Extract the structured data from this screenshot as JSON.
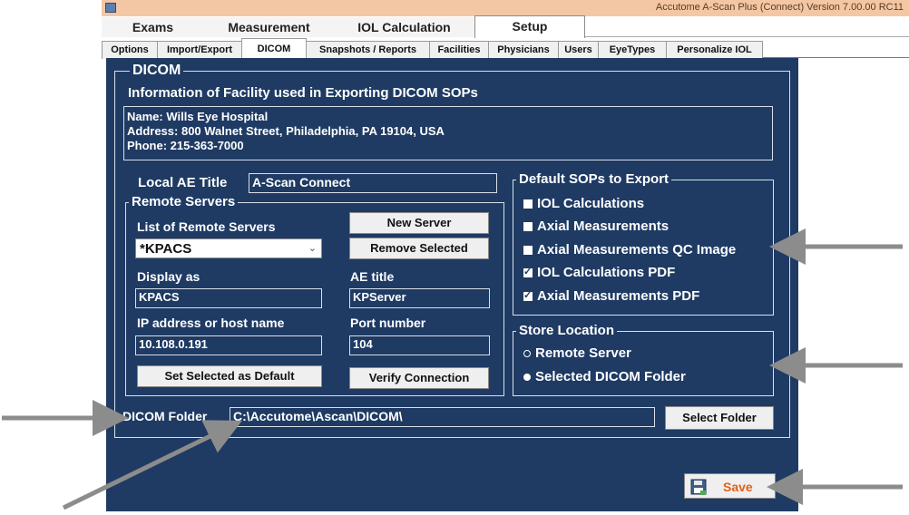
{
  "window": {
    "title": "Accutome A-Scan Plus (Connect) Version 7.00.00 RC11"
  },
  "main_tabs": [
    "Exams",
    "Measurement",
    "IOL Calculation",
    "Setup"
  ],
  "sub_tabs": [
    "Options",
    "Import/Export",
    "DICOM",
    "Snapshots / Reports",
    "Facilities",
    "Physicians",
    "Users",
    "EyeTypes",
    "Personalize IOL"
  ],
  "dicom": {
    "group_title": "DICOM",
    "facility_heading": "Information of Facility used in Exporting DICOM SOPs",
    "facility_lines": [
      "Name: Wills Eye Hospital",
      "Address: 800 Walnet Street, Philadelphia, PA 19104, USA",
      "Phone: 215-363-7000"
    ],
    "local_ae_label": "Local AE Title",
    "local_ae_value": "A-Scan Connect",
    "remote_servers": {
      "title": "Remote Servers",
      "list_label": "List of Remote Servers",
      "selected": "*KPACS",
      "new_server": "New Server",
      "remove_selected": "Remove Selected",
      "display_as_label": "Display as",
      "display_as_value": "KPACS",
      "ae_title_label": "AE title",
      "ae_title_value": "KPServer",
      "ip_label": "IP address or host name",
      "ip_value": "10.108.0.191",
      "port_label": "Port number",
      "port_value": "104",
      "set_default": "Set Selected as Default",
      "verify": "Verify Connection"
    },
    "default_sops": {
      "title": "Default SOPs to Export",
      "items": [
        {
          "label": "IOL Calculations",
          "checked": false
        },
        {
          "label": "Axial Measurements",
          "checked": false
        },
        {
          "label": "Axial Measurements QC Image",
          "checked": false
        },
        {
          "label": "IOL Calculations PDF",
          "checked": true
        },
        {
          "label": "Axial Measurements PDF",
          "checked": true
        }
      ]
    },
    "store_location": {
      "title": "Store Location",
      "options": [
        {
          "label": "Remote Server",
          "selected": false
        },
        {
          "label": "Selected DICOM Folder",
          "selected": true
        }
      ]
    },
    "folder_label": "DICOM Folder",
    "folder_value": "C:\\Accutome\\Ascan\\DICOM\\",
    "select_folder": "Select Folder",
    "save": "Save"
  },
  "colors": {
    "panel": "#1f3b64",
    "save_text": "#e0621b",
    "arrow": "#8c8c8c"
  }
}
